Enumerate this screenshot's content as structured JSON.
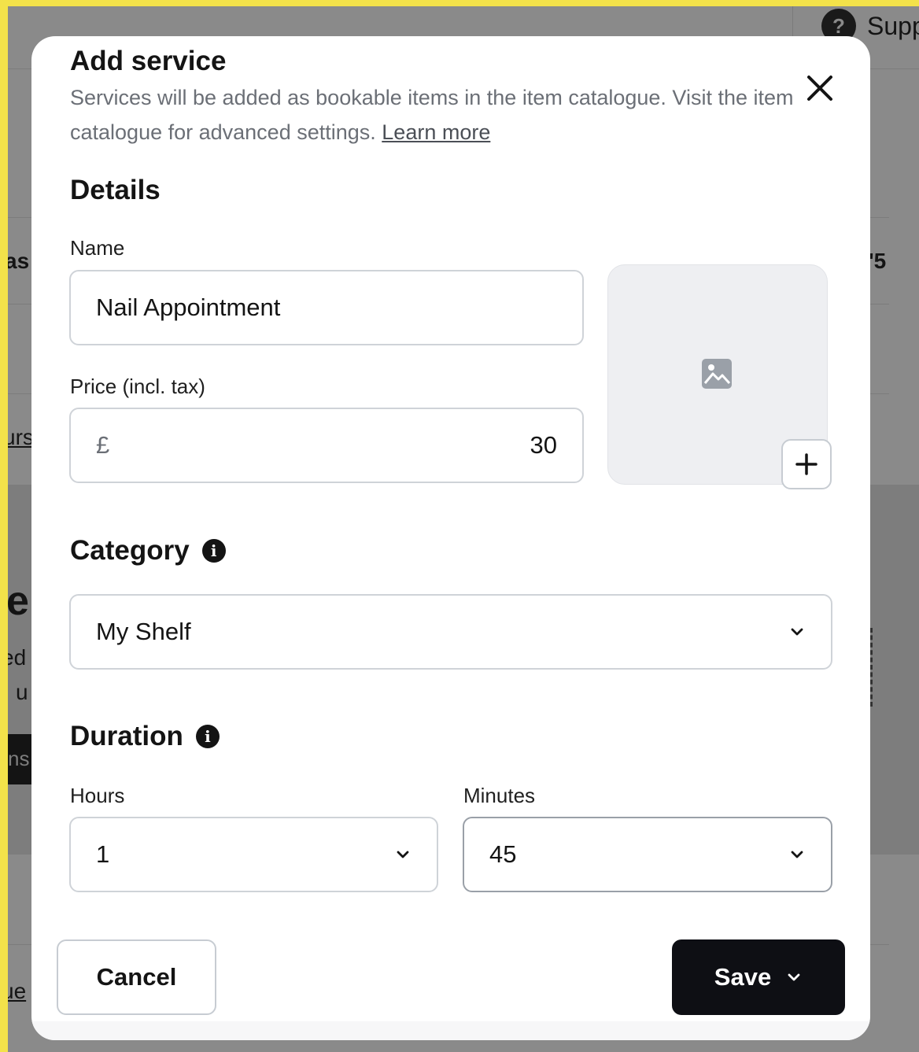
{
  "background": {
    "support_label": "Supp",
    "fragments": [
      "as",
      "'5",
      "urs",
      "e",
      "ed",
      "u",
      "ns",
      "ue"
    ]
  },
  "modal": {
    "title": "Add service",
    "description": "Services will be added as bookable items in the item catalogue. Visit the item catalogue for advanced settings.",
    "learn_more": "Learn more",
    "details": {
      "heading": "Details",
      "name_label": "Name",
      "name_value": "Nail Appointment",
      "price_label": "Price (incl. tax)",
      "currency_symbol": "£",
      "price_value": "30"
    },
    "category": {
      "heading": "Category",
      "selected": "My Shelf"
    },
    "duration": {
      "heading": "Duration",
      "hours_label": "Hours",
      "hours_value": "1",
      "minutes_label": "Minutes",
      "minutes_value": "45"
    },
    "footer": {
      "cancel_label": "Cancel",
      "save_label": "Save"
    }
  },
  "colors": {
    "frame": "#f3e24a",
    "overlay": "#8a8a8a",
    "primary_button": "#0e0f14",
    "input_border": "#cfd3d8"
  }
}
